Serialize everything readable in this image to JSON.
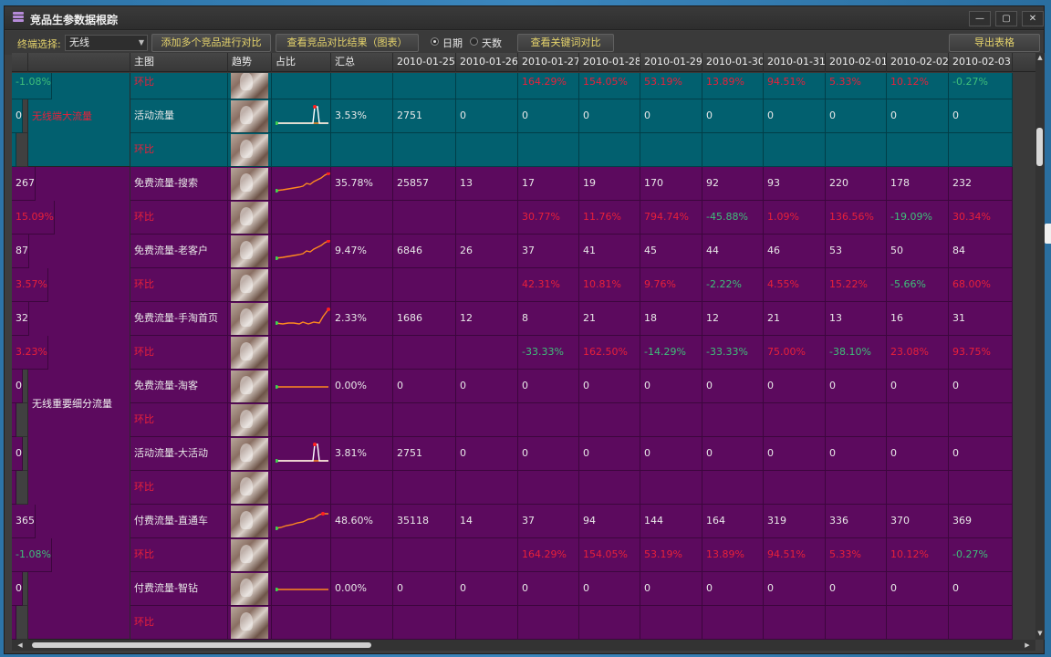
{
  "window": {
    "title": "竞品生参数据根踪",
    "min": "—",
    "max": "▢",
    "close": "✕"
  },
  "toolbar": {
    "terminal_label": "终端选择:",
    "terminal_value": "无线",
    "add_compare_btn": "添加多个竞品进行对比",
    "view_compare_btn": "查看竞品对比结果（图表）",
    "radio_date": "日期",
    "radio_days": "天数",
    "keyword_compare_btn": "查看关键词对比",
    "export_btn": "导出表格"
  },
  "columns": [
    "",
    "主图",
    "趋势",
    "占比",
    "汇总",
    "2010-01-25",
    "2010-01-26",
    "2010-01-27",
    "2010-01-28",
    "2010-01-29",
    "2010-01-30",
    "2010-01-31",
    "2010-02-01",
    "2010-02-02",
    "2010-02-03"
  ],
  "groups": [
    {
      "label": "无线端大流量",
      "rows": 3,
      "theme": "teal",
      "label_color": "red"
    },
    {
      "label": "无线重要细分流量",
      "rows": 14,
      "theme": "purple",
      "label_color": "white"
    }
  ],
  "rows": [
    {
      "name": "环比",
      "share": "",
      "total": "",
      "vals": [
        "",
        "164.29%",
        "154.05%",
        "53.19%",
        "13.89%",
        "94.51%",
        "5.33%",
        "10.12%",
        "-0.27%",
        "-1.08%"
      ],
      "kind": "ratio",
      "theme": "teal",
      "spark": ""
    },
    {
      "name": "活动流量",
      "share": "3.53%",
      "total": "2751",
      "vals": [
        "0",
        "0",
        "0",
        "0",
        "0",
        "0",
        "0",
        "0",
        "0",
        "0"
      ],
      "kind": "data",
      "theme": "teal",
      "spark": "spike"
    },
    {
      "name": "环比",
      "share": "",
      "total": "",
      "vals": [
        "",
        "",
        "",
        "",
        "",
        "",
        "",
        "",
        "",
        ""
      ],
      "kind": "ratio",
      "theme": "teal",
      "spark": ""
    },
    {
      "name": "免费流量-搜索",
      "share": "35.78%",
      "total": "25857",
      "vals": [
        "13",
        "17",
        "19",
        "170",
        "92",
        "93",
        "220",
        "178",
        "232",
        "267"
      ],
      "kind": "data",
      "theme": "purple",
      "spark": "rise"
    },
    {
      "name": "环比",
      "share": "",
      "total": "",
      "vals": [
        "",
        "30.77%",
        "11.76%",
        "794.74%",
        "-45.88%",
        "1.09%",
        "136.56%",
        "-19.09%",
        "30.34%",
        "15.09%"
      ],
      "kind": "ratio",
      "theme": "purple",
      "spark": ""
    },
    {
      "name": "免费流量-老客户",
      "share": "9.47%",
      "total": "6846",
      "vals": [
        "26",
        "37",
        "41",
        "45",
        "44",
        "46",
        "53",
        "50",
        "84",
        "87"
      ],
      "kind": "data",
      "theme": "purple",
      "spark": "rise"
    },
    {
      "name": "环比",
      "share": "",
      "total": "",
      "vals": [
        "",
        "42.31%",
        "10.81%",
        "9.76%",
        "-2.22%",
        "4.55%",
        "15.22%",
        "-5.66%",
        "68.00%",
        "3.57%"
      ],
      "kind": "ratio",
      "theme": "purple",
      "spark": ""
    },
    {
      "name": "免费流量-手淘首页",
      "share": "2.33%",
      "total": "1686",
      "vals": [
        "12",
        "8",
        "21",
        "18",
        "12",
        "21",
        "13",
        "16",
        "31",
        "32"
      ],
      "kind": "data",
      "theme": "purple",
      "spark": "rise2"
    },
    {
      "name": "环比",
      "share": "",
      "total": "",
      "vals": [
        "",
        "-33.33%",
        "162.50%",
        "-14.29%",
        "-33.33%",
        "75.00%",
        "-38.10%",
        "23.08%",
        "93.75%",
        "3.23%"
      ],
      "kind": "ratio",
      "theme": "purple",
      "spark": ""
    },
    {
      "name": "免费流量-淘客",
      "share": "0.00%",
      "total": "0",
      "vals": [
        "0",
        "0",
        "0",
        "0",
        "0",
        "0",
        "0",
        "0",
        "0",
        "0"
      ],
      "kind": "data",
      "theme": "purple",
      "spark": "flat"
    },
    {
      "name": "环比",
      "share": "",
      "total": "",
      "vals": [
        "",
        "",
        "",
        "",
        "",
        "",
        "",
        "",
        "",
        ""
      ],
      "kind": "ratio",
      "theme": "purple",
      "spark": ""
    },
    {
      "name": "活动流量-大活动",
      "share": "3.81%",
      "total": "2751",
      "vals": [
        "0",
        "0",
        "0",
        "0",
        "0",
        "0",
        "0",
        "0",
        "0",
        "0"
      ],
      "kind": "data",
      "theme": "purple",
      "spark": "spike"
    },
    {
      "name": "环比",
      "share": "",
      "total": "",
      "vals": [
        "",
        "",
        "",
        "",
        "",
        "",
        "",
        "",
        "",
        ""
      ],
      "kind": "ratio",
      "theme": "purple",
      "spark": ""
    },
    {
      "name": "付费流量-直通车",
      "share": "48.60%",
      "total": "35118",
      "vals": [
        "14",
        "37",
        "94",
        "144",
        "164",
        "319",
        "336",
        "370",
        "369",
        "365"
      ],
      "kind": "data",
      "theme": "purple",
      "spark": "rise3"
    },
    {
      "name": "环比",
      "share": "",
      "total": "",
      "vals": [
        "",
        "164.29%",
        "154.05%",
        "53.19%",
        "13.89%",
        "94.51%",
        "5.33%",
        "10.12%",
        "-0.27%",
        "-1.08%"
      ],
      "kind": "ratio",
      "theme": "purple",
      "spark": ""
    },
    {
      "name": "付费流量-智钻",
      "share": "0.00%",
      "total": "0",
      "vals": [
        "0",
        "0",
        "0",
        "0",
        "0",
        "0",
        "0",
        "0",
        "0",
        "0"
      ],
      "kind": "data",
      "theme": "purple",
      "spark": "flat"
    },
    {
      "name": "环比",
      "share": "",
      "total": "",
      "vals": [
        "",
        "",
        "",
        "",
        "",
        "",
        "",
        "",
        "",
        ""
      ],
      "kind": "ratio",
      "theme": "purple",
      "spark": ""
    }
  ],
  "colors": {
    "teal": "#02606f",
    "purple": "#5c0a5e",
    "up": "#e8203a",
    "down": "#3fbf7a",
    "accent": "#e5d36b"
  }
}
